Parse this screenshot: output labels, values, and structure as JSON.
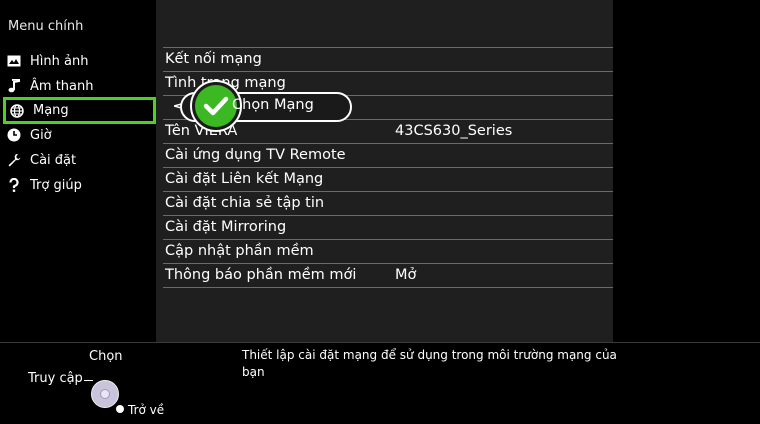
{
  "sidebar": {
    "title": "Menu chính",
    "items": [
      {
        "label": "Hình ảnh",
        "icon": "picture-icon"
      },
      {
        "label": "Âm thanh",
        "icon": "music-note-icon"
      },
      {
        "label": "Mạng",
        "icon": "globe-icon"
      },
      {
        "label": "Giờ",
        "icon": "clock-icon"
      },
      {
        "label": "Cài đặt",
        "icon": "wrench-icon"
      },
      {
        "label": "Trợ giúp",
        "icon": "question-icon"
      }
    ],
    "selected": "Mạng"
  },
  "network_menu": {
    "rows": [
      {
        "label": "Kết nối mạng",
        "value": ""
      },
      {
        "label": "Tình trạng mạng",
        "value": ""
      },
      {
        "label": "",
        "value": ""
      },
      {
        "label": "Tên VIERA",
        "value": "43CS630_Series"
      },
      {
        "label": "Cài ứng dụng TV Remote",
        "value": ""
      },
      {
        "label": "Cài đặt Liên kết Mạng",
        "value": ""
      },
      {
        "label": "Cài đặt chia sẻ tập tin",
        "value": ""
      },
      {
        "label": "Cài đặt Mirroring",
        "value": ""
      },
      {
        "label": "Cập nhật phần mềm",
        "value": ""
      },
      {
        "label": "Thông báo phần mềm mới",
        "value": "Mở"
      }
    ]
  },
  "callout": {
    "text": "Chọn Mạng",
    "icon": "checkmark-icon"
  },
  "footer": {
    "select_hint": "Chọn",
    "access_hint": "Truy cập",
    "back_hint": "Trở về",
    "description": "Thiết lập cài đặt mạng để sử dụng trong môi trường mạng của bạn"
  },
  "colors": {
    "selection_border": "#4ed11f",
    "check_green": "#3cb823",
    "panel_bg": "#1f1f1f"
  }
}
